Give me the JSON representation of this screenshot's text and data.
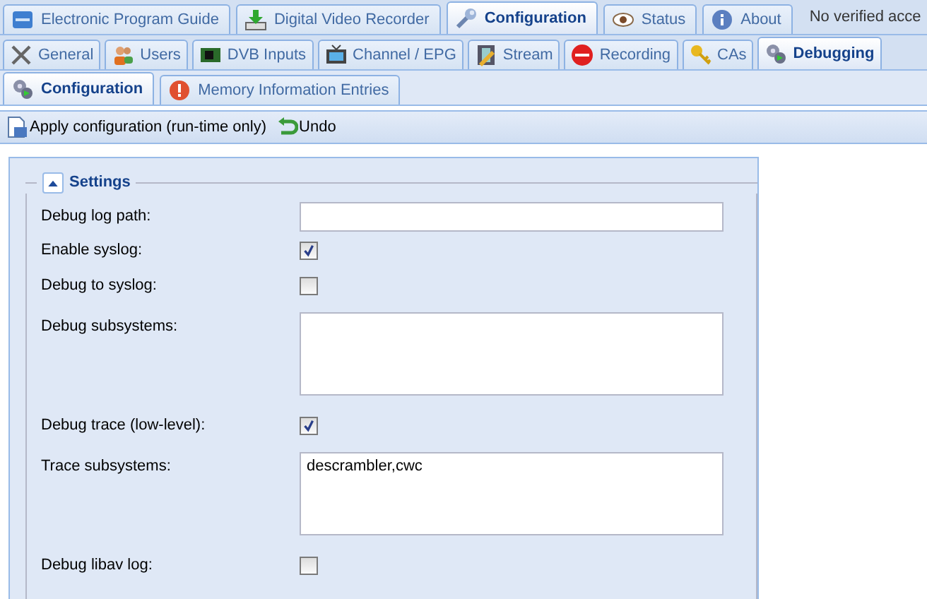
{
  "main_tabs": [
    {
      "label": "Electronic Program Guide",
      "selected": false
    },
    {
      "label": "Digital Video Recorder",
      "selected": false
    },
    {
      "label": "Configuration",
      "selected": true
    },
    {
      "label": "Status",
      "selected": false
    },
    {
      "label": "About",
      "selected": false
    }
  ],
  "status_text": "No verified acce",
  "config_tabs": [
    {
      "label": "General",
      "selected": false
    },
    {
      "label": "Users",
      "selected": false
    },
    {
      "label": "DVB Inputs",
      "selected": false
    },
    {
      "label": "Channel / EPG",
      "selected": false
    },
    {
      "label": "Stream",
      "selected": false
    },
    {
      "label": "Recording",
      "selected": false
    },
    {
      "label": "CAs",
      "selected": false
    },
    {
      "label": "Debugging",
      "selected": true
    }
  ],
  "debug_tabs": [
    {
      "label": "Configuration",
      "selected": true
    },
    {
      "label": "Memory Information Entries",
      "selected": false
    }
  ],
  "toolbar": [
    {
      "label": "Apply configuration (run-time only)"
    },
    {
      "label": "Undo"
    }
  ],
  "settings": {
    "title": "Settings",
    "expanded": true,
    "fields": [
      {
        "kind": "text",
        "label": "Debug log path:"
      },
      {
        "kind": "checkbox",
        "label": "Enable syslog:",
        "checked": true
      },
      {
        "kind": "checkbox",
        "label": "Debug to syslog:",
        "checked": false
      },
      {
        "kind": "textarea",
        "label": "Debug subsystems:"
      },
      {
        "kind": "checkbox",
        "label": "Debug trace (low-level):",
        "checked": true
      },
      {
        "kind": "textarea",
        "label": "Trace subsystems:",
        "value": "descrambler,cwc"
      },
      {
        "kind": "checkbox",
        "label": "Debug libav log:",
        "checked": false
      }
    ]
  }
}
